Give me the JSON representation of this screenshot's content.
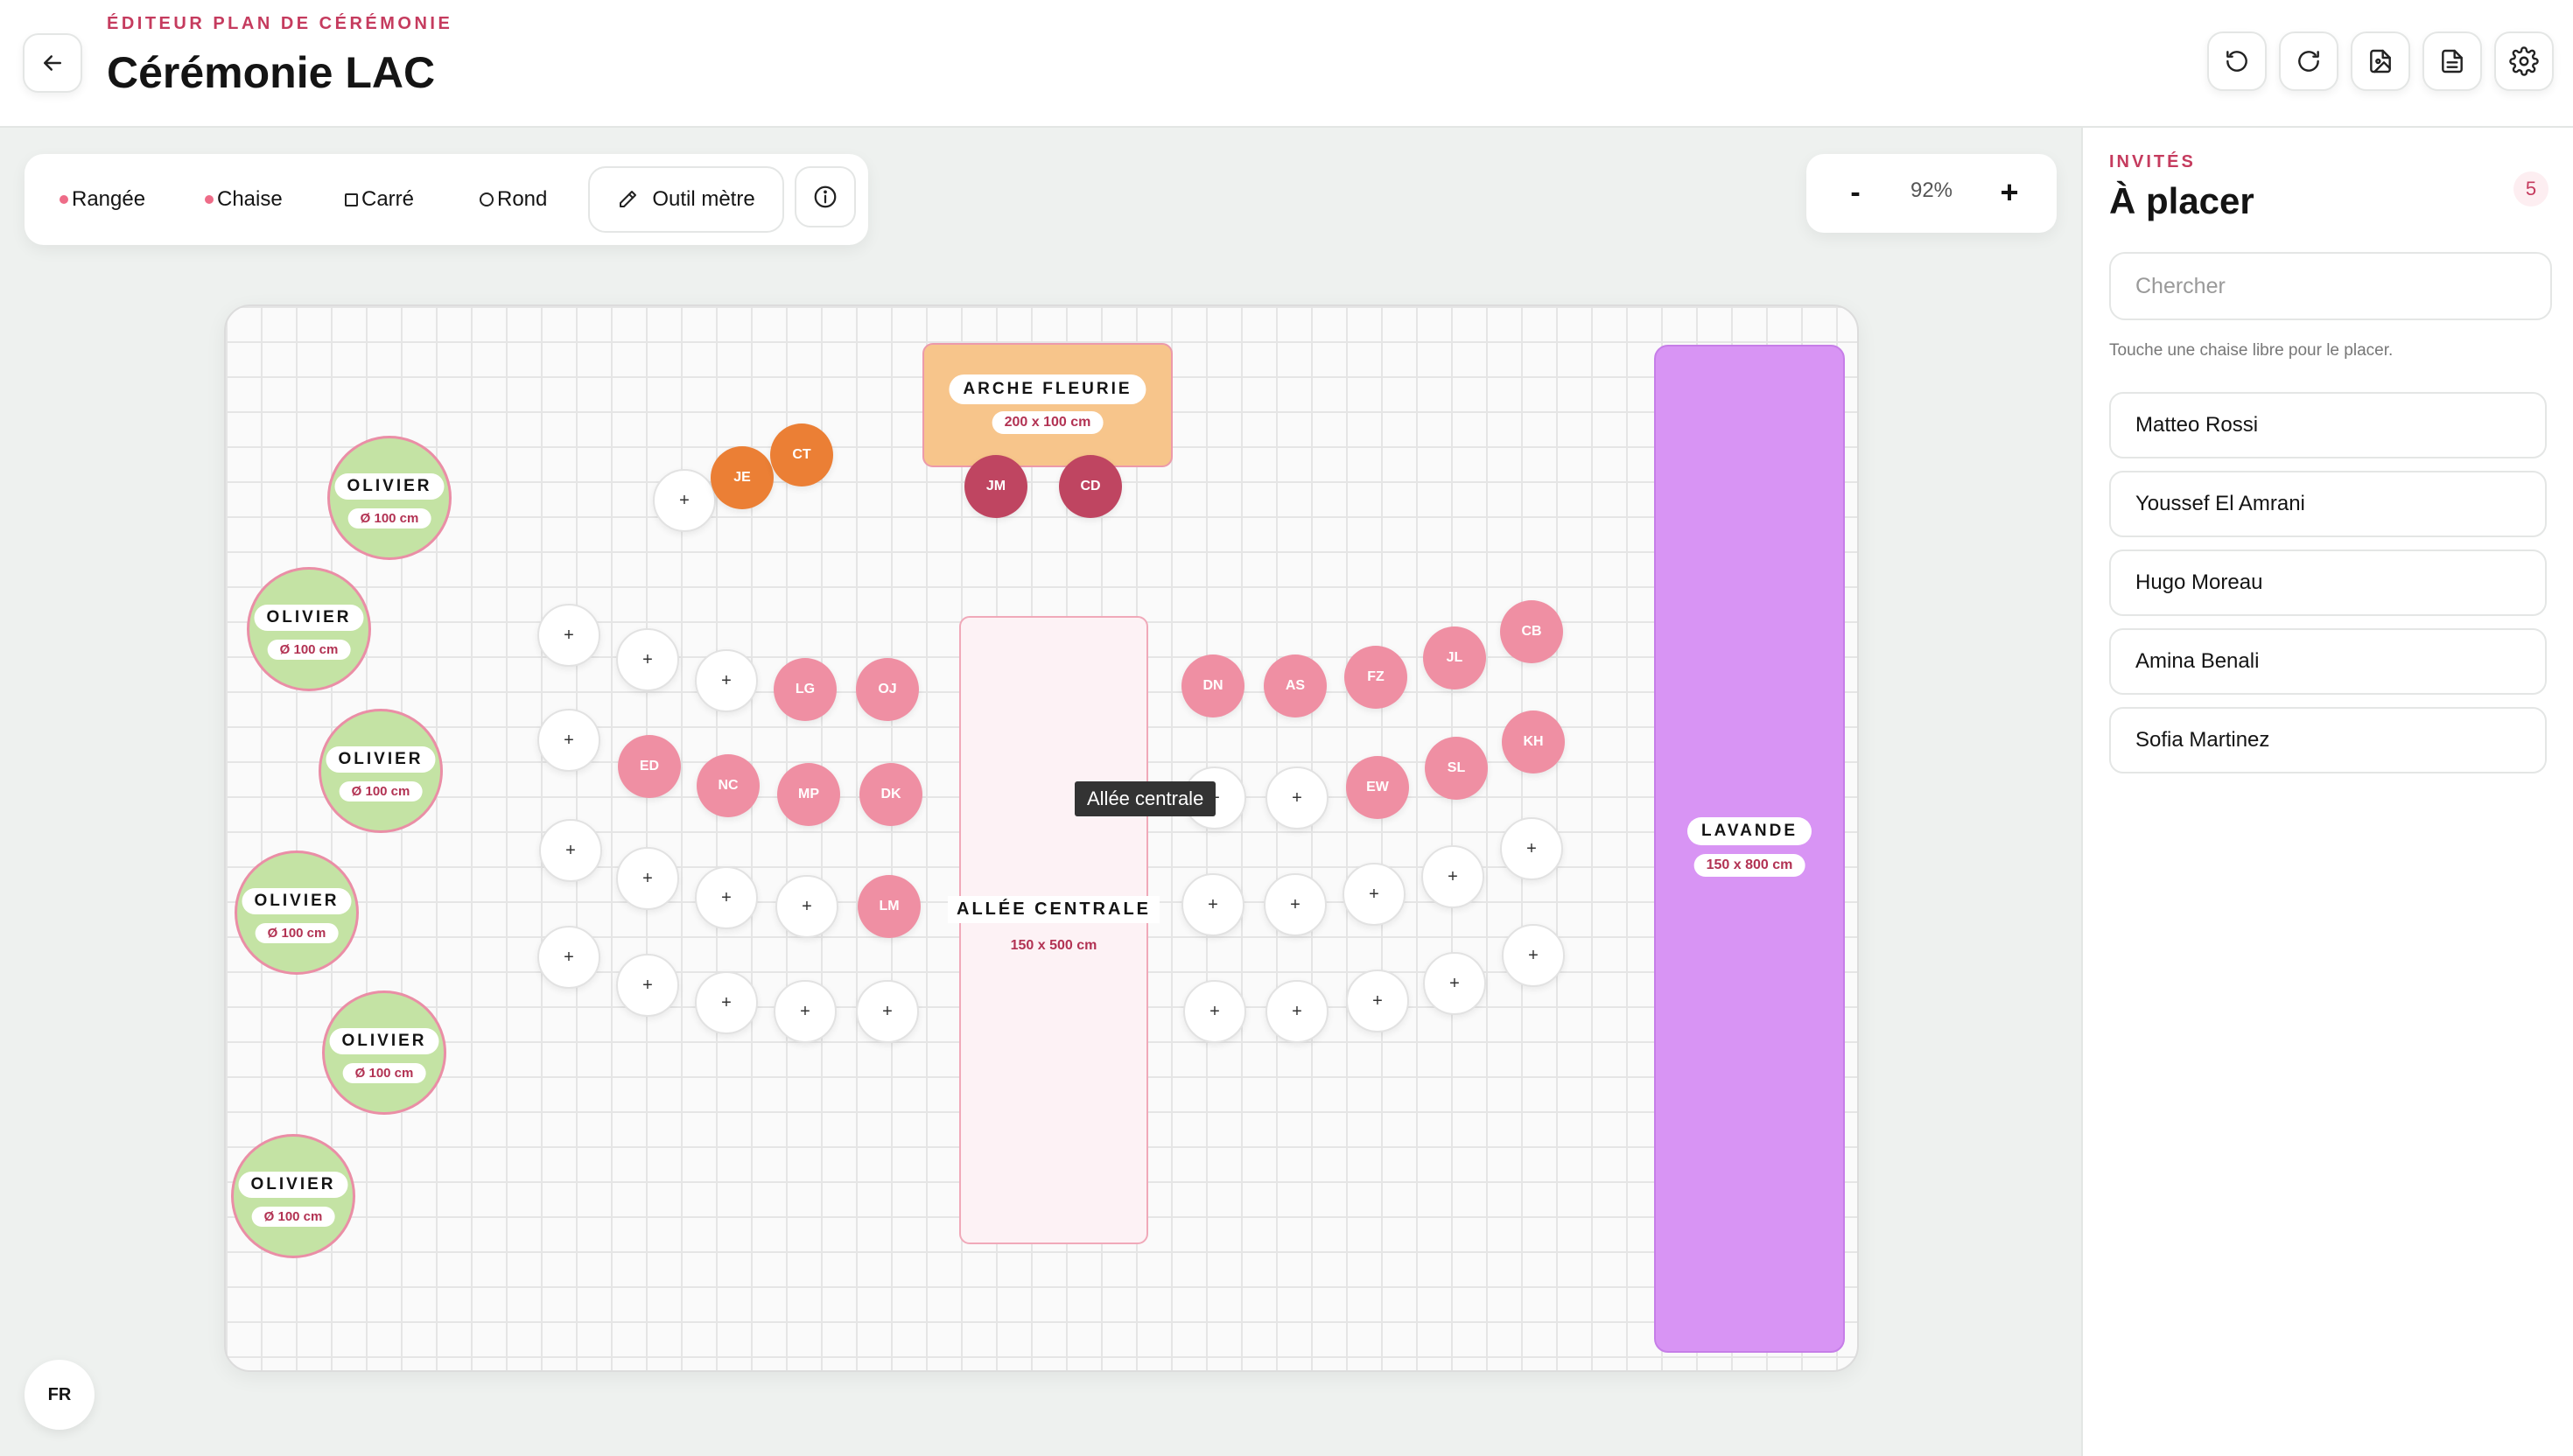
{
  "header": {
    "eyebrow": "ÉDITEUR PLAN DE CÉRÉMONIE",
    "title": "Cérémonie LAC",
    "icons": [
      "undo-icon",
      "redo-icon",
      "export-image-icon",
      "export-document-icon",
      "settings-icon"
    ]
  },
  "toolbar": {
    "tools": [
      "Rangée",
      "Chaise",
      "Carré",
      "Rond"
    ],
    "meter_label": "Outil mètre"
  },
  "zoom": {
    "minus": "-",
    "value": "92%",
    "plus": "+"
  },
  "canvas": {
    "olive_trees": [
      {
        "name": "OLIVIER",
        "size": "Ø 100 cm"
      },
      {
        "name": "OLIVIER",
        "size": "Ø 100 cm"
      },
      {
        "name": "OLIVIER",
        "size": "Ø 100 cm"
      },
      {
        "name": "OLIVIER",
        "size": "Ø 100 cm"
      },
      {
        "name": "OLIVIER",
        "size": "Ø 100 cm"
      },
      {
        "name": "OLIVIER",
        "size": "Ø 100 cm"
      }
    ],
    "arch": {
      "name": "ARCHE FLEURIE",
      "size": "200 x 100 cm"
    },
    "aisle": {
      "name": "ALLÉE CENTRALE",
      "size": "150 x 500 cm",
      "tooltip": "Allée centrale"
    },
    "lavender": {
      "name": "LAVANDE",
      "size": "150 x 800 cm"
    },
    "chair_colors": {
      "pink": "#ef8fa3",
      "orange": "#eb7f35",
      "wine": "#bf4561"
    },
    "chairs": {
      "front": [
        "+",
        "JE",
        "CT",
        "JM",
        "CD"
      ],
      "left": [
        "+",
        "+",
        "+",
        "LG",
        "OJ",
        "+",
        "ED",
        "NC",
        "MP",
        "DK",
        "+",
        "+",
        "+",
        "+",
        "LM",
        "+",
        "+",
        "+",
        "+",
        "+"
      ],
      "right": [
        "DN",
        "AS",
        "FZ",
        "JL",
        "CB",
        "+",
        "+",
        "EW",
        "SL",
        "KH",
        "+",
        "+",
        "+",
        "+",
        "+",
        "+",
        "+",
        "+",
        "+",
        "+"
      ]
    }
  },
  "language": "FR",
  "sidebar": {
    "eyebrow": "INVITÉS",
    "title": "À placer",
    "count": "5",
    "search_placeholder": "Chercher",
    "hint": "Touche une chaise libre pour le placer.",
    "guests": [
      "Matteo Rossi",
      "Youssef El Amrani",
      "Hugo Moreau",
      "Amina Benali",
      "Sofia Martinez"
    ]
  }
}
